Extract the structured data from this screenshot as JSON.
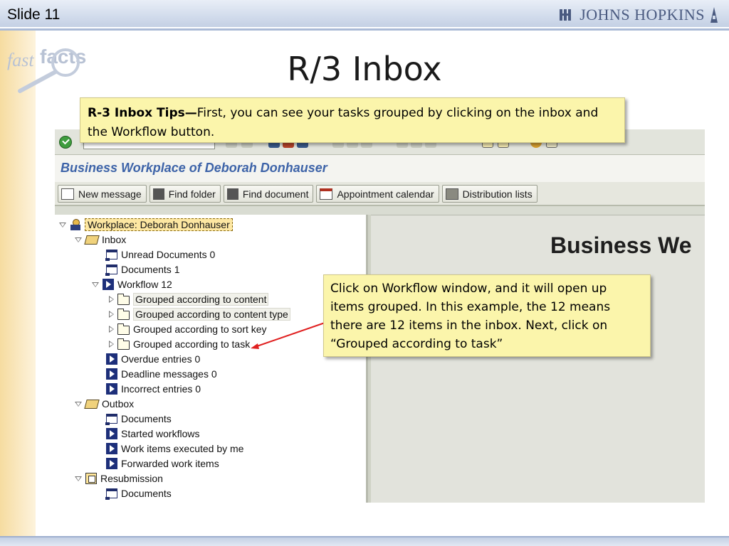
{
  "slide": {
    "label": "Slide 11",
    "title": "R/3 Inbox",
    "logo_text": "JOHNS HOPKINS",
    "brand_fast": "fast",
    "brand_facts": "facts"
  },
  "callouts": {
    "top_bold": "R-3 Inbox Tips—",
    "top_text": "First, you can see your tasks grouped by clicking on the inbox and the Workflow button.",
    "right_text": "Click on Workflow window, and it will open up items grouped. In this example, the 12 means there are 12 items in the inbox. Next, click on “Grouped according to task”"
  },
  "sap": {
    "workplace_title": "Business Workplace of Deborah Donhauser",
    "buttons": [
      {
        "label": "New message",
        "icon": "new-message-icon"
      },
      {
        "label": "Find folder",
        "icon": "binoculars-icon"
      },
      {
        "label": "Find document",
        "icon": "binoculars-icon"
      },
      {
        "label": "Appointment calendar",
        "icon": "calendar-icon"
      },
      {
        "label": "Distribution lists",
        "icon": "distribution-icon"
      }
    ],
    "right_pane_title": "Business We",
    "tree": {
      "workplace": "Workplace: Deborah Donhauser",
      "inbox": "Inbox",
      "unread": "Unread Documents 0",
      "documents": "Documents 1",
      "workflow": "Workflow 12",
      "grouped_content": "Grouped according to content",
      "grouped_content_type": "Grouped according to content type",
      "grouped_sort_key": "Grouped according to sort key",
      "grouped_task": "Grouped according to task",
      "overdue": "Overdue entries 0",
      "deadline": "Deadline messages 0",
      "incorrect": "Incorrect entries 0",
      "outbox": "Outbox",
      "outbox_documents": "Documents",
      "started_workflows": "Started workflows",
      "executed_by_me": "Work items executed by me",
      "forwarded": "Forwarded work items",
      "resubmission": "Resubmission",
      "resub_documents": "Documents"
    }
  },
  "colors": {
    "callout_bg": "#fbf5ab",
    "sap_title": "#3d63a8",
    "arrow": "#e02020",
    "header": "#d2dcec"
  }
}
